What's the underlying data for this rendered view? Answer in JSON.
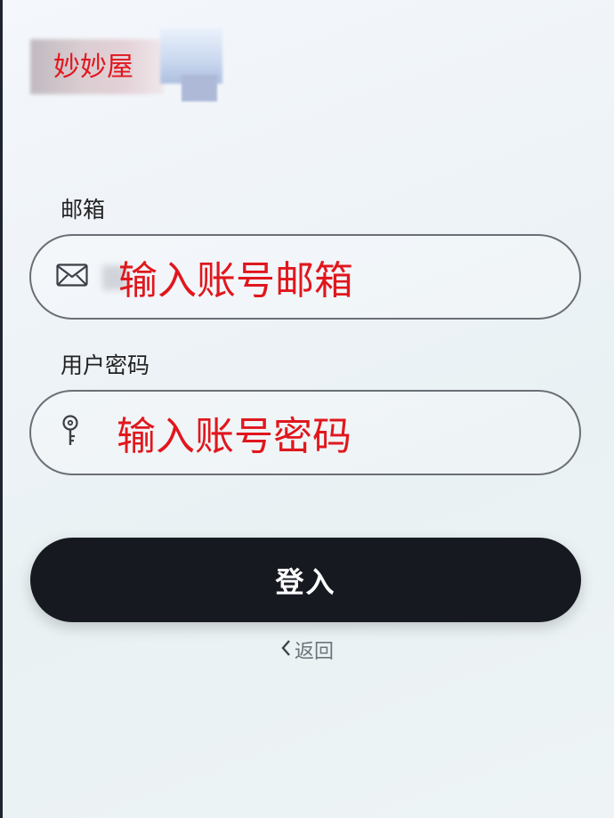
{
  "brand": {
    "label": "妙妙屋"
  },
  "email": {
    "label": "邮箱",
    "overlay_text": "输入账号邮箱",
    "icon": "mail-icon"
  },
  "password": {
    "label": "用户密码",
    "overlay_text": "输入账号密码",
    "icon": "key-icon"
  },
  "login": {
    "button_label": "登入"
  },
  "back": {
    "label": "返回",
    "icon": "chevron-left-icon"
  },
  "colors": {
    "annotation_red": "#e0171d",
    "button_dark": "#161a20",
    "field_border": "#6b6f76"
  }
}
